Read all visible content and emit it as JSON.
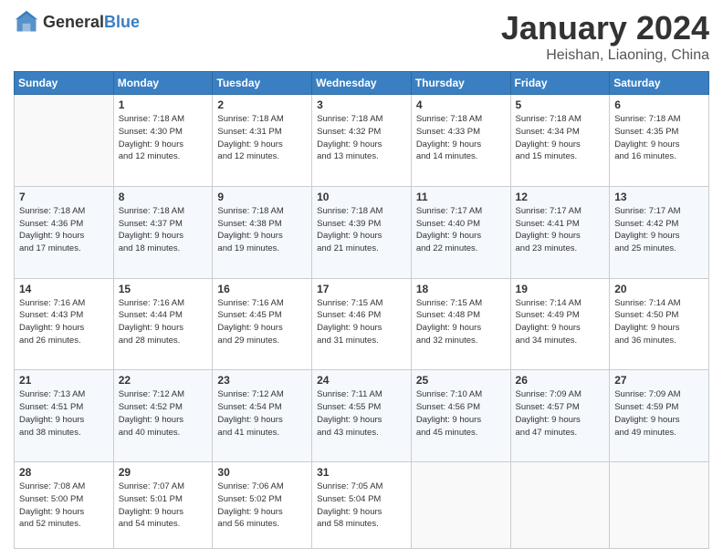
{
  "header": {
    "logo_general": "General",
    "logo_blue": "Blue",
    "title": "January 2024",
    "location": "Heishan, Liaoning, China"
  },
  "weekdays": [
    "Sunday",
    "Monday",
    "Tuesday",
    "Wednesday",
    "Thursday",
    "Friday",
    "Saturday"
  ],
  "weeks": [
    [
      {
        "day": "",
        "info": ""
      },
      {
        "day": "1",
        "info": "Sunrise: 7:18 AM\nSunset: 4:30 PM\nDaylight: 9 hours\nand 12 minutes."
      },
      {
        "day": "2",
        "info": "Sunrise: 7:18 AM\nSunset: 4:31 PM\nDaylight: 9 hours\nand 12 minutes."
      },
      {
        "day": "3",
        "info": "Sunrise: 7:18 AM\nSunset: 4:32 PM\nDaylight: 9 hours\nand 13 minutes."
      },
      {
        "day": "4",
        "info": "Sunrise: 7:18 AM\nSunset: 4:33 PM\nDaylight: 9 hours\nand 14 minutes."
      },
      {
        "day": "5",
        "info": "Sunrise: 7:18 AM\nSunset: 4:34 PM\nDaylight: 9 hours\nand 15 minutes."
      },
      {
        "day": "6",
        "info": "Sunrise: 7:18 AM\nSunset: 4:35 PM\nDaylight: 9 hours\nand 16 minutes."
      }
    ],
    [
      {
        "day": "7",
        "info": "Sunrise: 7:18 AM\nSunset: 4:36 PM\nDaylight: 9 hours\nand 17 minutes."
      },
      {
        "day": "8",
        "info": "Sunrise: 7:18 AM\nSunset: 4:37 PM\nDaylight: 9 hours\nand 18 minutes."
      },
      {
        "day": "9",
        "info": "Sunrise: 7:18 AM\nSunset: 4:38 PM\nDaylight: 9 hours\nand 19 minutes."
      },
      {
        "day": "10",
        "info": "Sunrise: 7:18 AM\nSunset: 4:39 PM\nDaylight: 9 hours\nand 21 minutes."
      },
      {
        "day": "11",
        "info": "Sunrise: 7:17 AM\nSunset: 4:40 PM\nDaylight: 9 hours\nand 22 minutes."
      },
      {
        "day": "12",
        "info": "Sunrise: 7:17 AM\nSunset: 4:41 PM\nDaylight: 9 hours\nand 23 minutes."
      },
      {
        "day": "13",
        "info": "Sunrise: 7:17 AM\nSunset: 4:42 PM\nDaylight: 9 hours\nand 25 minutes."
      }
    ],
    [
      {
        "day": "14",
        "info": "Sunrise: 7:16 AM\nSunset: 4:43 PM\nDaylight: 9 hours\nand 26 minutes."
      },
      {
        "day": "15",
        "info": "Sunrise: 7:16 AM\nSunset: 4:44 PM\nDaylight: 9 hours\nand 28 minutes."
      },
      {
        "day": "16",
        "info": "Sunrise: 7:16 AM\nSunset: 4:45 PM\nDaylight: 9 hours\nand 29 minutes."
      },
      {
        "day": "17",
        "info": "Sunrise: 7:15 AM\nSunset: 4:46 PM\nDaylight: 9 hours\nand 31 minutes."
      },
      {
        "day": "18",
        "info": "Sunrise: 7:15 AM\nSunset: 4:48 PM\nDaylight: 9 hours\nand 32 minutes."
      },
      {
        "day": "19",
        "info": "Sunrise: 7:14 AM\nSunset: 4:49 PM\nDaylight: 9 hours\nand 34 minutes."
      },
      {
        "day": "20",
        "info": "Sunrise: 7:14 AM\nSunset: 4:50 PM\nDaylight: 9 hours\nand 36 minutes."
      }
    ],
    [
      {
        "day": "21",
        "info": "Sunrise: 7:13 AM\nSunset: 4:51 PM\nDaylight: 9 hours\nand 38 minutes."
      },
      {
        "day": "22",
        "info": "Sunrise: 7:12 AM\nSunset: 4:52 PM\nDaylight: 9 hours\nand 40 minutes."
      },
      {
        "day": "23",
        "info": "Sunrise: 7:12 AM\nSunset: 4:54 PM\nDaylight: 9 hours\nand 41 minutes."
      },
      {
        "day": "24",
        "info": "Sunrise: 7:11 AM\nSunset: 4:55 PM\nDaylight: 9 hours\nand 43 minutes."
      },
      {
        "day": "25",
        "info": "Sunrise: 7:10 AM\nSunset: 4:56 PM\nDaylight: 9 hours\nand 45 minutes."
      },
      {
        "day": "26",
        "info": "Sunrise: 7:09 AM\nSunset: 4:57 PM\nDaylight: 9 hours\nand 47 minutes."
      },
      {
        "day": "27",
        "info": "Sunrise: 7:09 AM\nSunset: 4:59 PM\nDaylight: 9 hours\nand 49 minutes."
      }
    ],
    [
      {
        "day": "28",
        "info": "Sunrise: 7:08 AM\nSunset: 5:00 PM\nDaylight: 9 hours\nand 52 minutes."
      },
      {
        "day": "29",
        "info": "Sunrise: 7:07 AM\nSunset: 5:01 PM\nDaylight: 9 hours\nand 54 minutes."
      },
      {
        "day": "30",
        "info": "Sunrise: 7:06 AM\nSunset: 5:02 PM\nDaylight: 9 hours\nand 56 minutes."
      },
      {
        "day": "31",
        "info": "Sunrise: 7:05 AM\nSunset: 5:04 PM\nDaylight: 9 hours\nand 58 minutes."
      },
      {
        "day": "",
        "info": ""
      },
      {
        "day": "",
        "info": ""
      },
      {
        "day": "",
        "info": ""
      }
    ]
  ]
}
